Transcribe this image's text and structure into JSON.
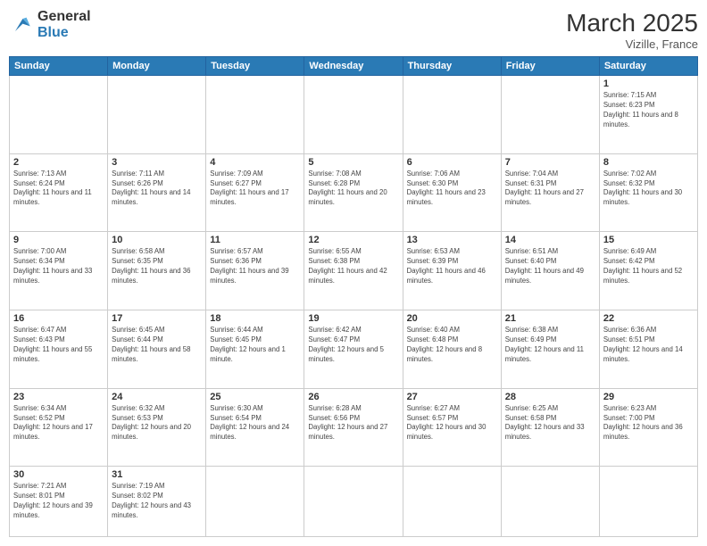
{
  "header": {
    "logo_general": "General",
    "logo_blue": "Blue",
    "title": "March 2025",
    "location": "Vizille, France"
  },
  "days_of_week": [
    "Sunday",
    "Monday",
    "Tuesday",
    "Wednesday",
    "Thursday",
    "Friday",
    "Saturday"
  ],
  "weeks": [
    [
      {
        "day": "",
        "info": ""
      },
      {
        "day": "",
        "info": ""
      },
      {
        "day": "",
        "info": ""
      },
      {
        "day": "",
        "info": ""
      },
      {
        "day": "",
        "info": ""
      },
      {
        "day": "",
        "info": ""
      },
      {
        "day": "1",
        "info": "Sunrise: 7:15 AM\nSunset: 6:23 PM\nDaylight: 11 hours and 8 minutes."
      }
    ],
    [
      {
        "day": "2",
        "info": "Sunrise: 7:13 AM\nSunset: 6:24 PM\nDaylight: 11 hours and 11 minutes."
      },
      {
        "day": "3",
        "info": "Sunrise: 7:11 AM\nSunset: 6:26 PM\nDaylight: 11 hours and 14 minutes."
      },
      {
        "day": "4",
        "info": "Sunrise: 7:09 AM\nSunset: 6:27 PM\nDaylight: 11 hours and 17 minutes."
      },
      {
        "day": "5",
        "info": "Sunrise: 7:08 AM\nSunset: 6:28 PM\nDaylight: 11 hours and 20 minutes."
      },
      {
        "day": "6",
        "info": "Sunrise: 7:06 AM\nSunset: 6:30 PM\nDaylight: 11 hours and 23 minutes."
      },
      {
        "day": "7",
        "info": "Sunrise: 7:04 AM\nSunset: 6:31 PM\nDaylight: 11 hours and 27 minutes."
      },
      {
        "day": "8",
        "info": "Sunrise: 7:02 AM\nSunset: 6:32 PM\nDaylight: 11 hours and 30 minutes."
      }
    ],
    [
      {
        "day": "9",
        "info": "Sunrise: 7:00 AM\nSunset: 6:34 PM\nDaylight: 11 hours and 33 minutes."
      },
      {
        "day": "10",
        "info": "Sunrise: 6:58 AM\nSunset: 6:35 PM\nDaylight: 11 hours and 36 minutes."
      },
      {
        "day": "11",
        "info": "Sunrise: 6:57 AM\nSunset: 6:36 PM\nDaylight: 11 hours and 39 minutes."
      },
      {
        "day": "12",
        "info": "Sunrise: 6:55 AM\nSunset: 6:38 PM\nDaylight: 11 hours and 42 minutes."
      },
      {
        "day": "13",
        "info": "Sunrise: 6:53 AM\nSunset: 6:39 PM\nDaylight: 11 hours and 46 minutes."
      },
      {
        "day": "14",
        "info": "Sunrise: 6:51 AM\nSunset: 6:40 PM\nDaylight: 11 hours and 49 minutes."
      },
      {
        "day": "15",
        "info": "Sunrise: 6:49 AM\nSunset: 6:42 PM\nDaylight: 11 hours and 52 minutes."
      }
    ],
    [
      {
        "day": "16",
        "info": "Sunrise: 6:47 AM\nSunset: 6:43 PM\nDaylight: 11 hours and 55 minutes."
      },
      {
        "day": "17",
        "info": "Sunrise: 6:45 AM\nSunset: 6:44 PM\nDaylight: 11 hours and 58 minutes."
      },
      {
        "day": "18",
        "info": "Sunrise: 6:44 AM\nSunset: 6:45 PM\nDaylight: 12 hours and 1 minute."
      },
      {
        "day": "19",
        "info": "Sunrise: 6:42 AM\nSunset: 6:47 PM\nDaylight: 12 hours and 5 minutes."
      },
      {
        "day": "20",
        "info": "Sunrise: 6:40 AM\nSunset: 6:48 PM\nDaylight: 12 hours and 8 minutes."
      },
      {
        "day": "21",
        "info": "Sunrise: 6:38 AM\nSunset: 6:49 PM\nDaylight: 12 hours and 11 minutes."
      },
      {
        "day": "22",
        "info": "Sunrise: 6:36 AM\nSunset: 6:51 PM\nDaylight: 12 hours and 14 minutes."
      }
    ],
    [
      {
        "day": "23",
        "info": "Sunrise: 6:34 AM\nSunset: 6:52 PM\nDaylight: 12 hours and 17 minutes."
      },
      {
        "day": "24",
        "info": "Sunrise: 6:32 AM\nSunset: 6:53 PM\nDaylight: 12 hours and 20 minutes."
      },
      {
        "day": "25",
        "info": "Sunrise: 6:30 AM\nSunset: 6:54 PM\nDaylight: 12 hours and 24 minutes."
      },
      {
        "day": "26",
        "info": "Sunrise: 6:28 AM\nSunset: 6:56 PM\nDaylight: 12 hours and 27 minutes."
      },
      {
        "day": "27",
        "info": "Sunrise: 6:27 AM\nSunset: 6:57 PM\nDaylight: 12 hours and 30 minutes."
      },
      {
        "day": "28",
        "info": "Sunrise: 6:25 AM\nSunset: 6:58 PM\nDaylight: 12 hours and 33 minutes."
      },
      {
        "day": "29",
        "info": "Sunrise: 6:23 AM\nSunset: 7:00 PM\nDaylight: 12 hours and 36 minutes."
      }
    ],
    [
      {
        "day": "30",
        "info": "Sunrise: 7:21 AM\nSunset: 8:01 PM\nDaylight: 12 hours and 39 minutes."
      },
      {
        "day": "31",
        "info": "Sunrise: 7:19 AM\nSunset: 8:02 PM\nDaylight: 12 hours and 43 minutes."
      },
      {
        "day": "",
        "info": ""
      },
      {
        "day": "",
        "info": ""
      },
      {
        "day": "",
        "info": ""
      },
      {
        "day": "",
        "info": ""
      },
      {
        "day": "",
        "info": ""
      }
    ]
  ]
}
